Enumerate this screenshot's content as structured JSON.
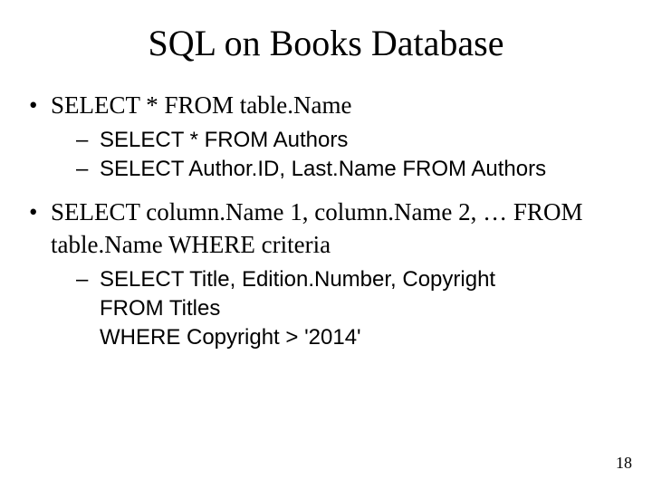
{
  "title": "SQL on Books Database",
  "bullets": {
    "b1": {
      "text": "SELECT * FROM table.Name",
      "sub1": "SELECT * FROM Authors",
      "sub2": "SELECT Author.ID, Last.Name FROM Authors"
    },
    "b2": {
      "text": "SELECT column.Name 1, column.Name 2, … FROM table.Name WHERE criteria",
      "sub1": "SELECT Title, Edition.Number, Copyright",
      "sub2": "FROM Titles",
      "sub3": "WHERE Copyright > '2014'"
    }
  },
  "page_number": "18"
}
